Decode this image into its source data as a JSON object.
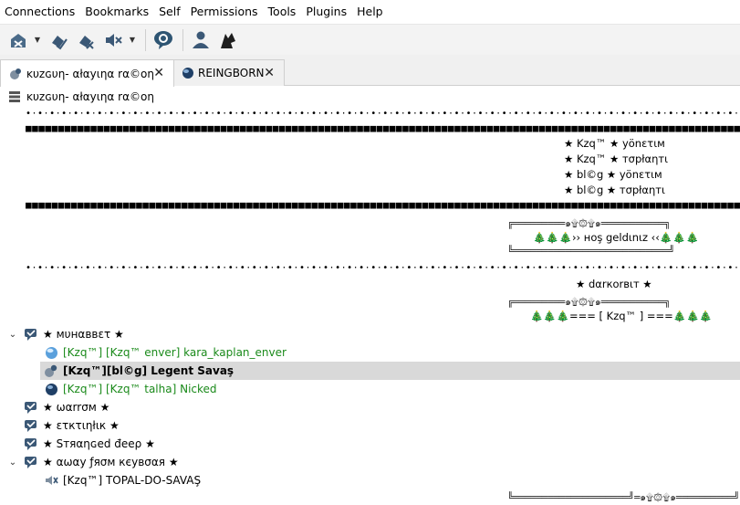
{
  "menubar": {
    "items": [
      "Connections",
      "Bookmarks",
      "Self",
      "Permissions",
      "Tools",
      "Plugins",
      "Help"
    ]
  },
  "tabs": [
    {
      "label": "ĸυzɢυη- αłαyιηα rα©οη"
    },
    {
      "label": "REINGBORN"
    }
  ],
  "server": {
    "name": "ĸυzɢυη- αłαyιηα rα©οη"
  },
  "banner": {
    "dots": "•·•·•·•·•·•·•·•·•·•·•·•·•·•·•·•·•·•·•·•·•·•·•·•·•·•·•·•·•·•·•·•·•·•·•·•·•·•·•·•·•·•·•·•·•·•·•·•·•·•·•·•·•·•·•·•·•·•·•·•·•·•·•·•·•·•·",
    "blocks": "■■■■■■■■■■■■■■■■■■■■■■■■■■■■■■■■■■■■■■■■■■■■■■■■■■■■■■■■■■■■■■■■■■■■■■■■■■■■■■■■■■■■■■■■■■■■■■■■■■■■■■■■■■■■■■■■■■■",
    "staff_lines": [
      "★ Kzq™ ★ yönετιм",
      "★ Kzq™ ★ тσpłαηтι",
      "★ bl©g ★ yönετιм",
      "★ bl©g ★ тσpłαηтι"
    ],
    "frame_top": "╔═════════๑۩۞۩๑═══════════╗",
    "welcome": "🎄🎄🎄›› нoş geldιnιz ‹‹🎄🎄🎄",
    "frame_bottom": "╚═══════════════════════════╝",
    "darkorbit": "★ dαrкorвιт ★",
    "frame_mid": "╔═════════๑۩۞۩๑═══════════╗",
    "kzq_line": "🎄🎄🎄=== [ Kzq™ ] ===🎄🎄🎄",
    "frame_end": "╚════════════════════╝═๑۩۞۩๑══════════╝"
  },
  "channels": [
    {
      "name": "★ мυнαввετ ★",
      "expanded": true
    },
    {
      "name": "★ ωαrrσм ★",
      "expanded": false
    },
    {
      "name": "★ ετкτιηłιк ★",
      "expanded": false
    },
    {
      "name": "★ Sтяαηɢed đeeρ ★",
      "expanded": false
    },
    {
      "name": "★ αωαy ƒяσм кєувσαя ★",
      "expanded": true
    }
  ],
  "users": [
    {
      "name": "[Kzq™] [Kzq™ enver] kara_kaplan_enver",
      "color": "#1a8a1a"
    },
    {
      "name": "[Kzq™][bl©g] Legent Savaş",
      "color": "#000000"
    },
    {
      "name": "[Kzq™] [Kzq™ talha] Nicked",
      "color": "#1a8a1a"
    },
    {
      "name": "[Kzq™] TOPAL-DO-SAVAŞ",
      "color": "#000000"
    }
  ]
}
